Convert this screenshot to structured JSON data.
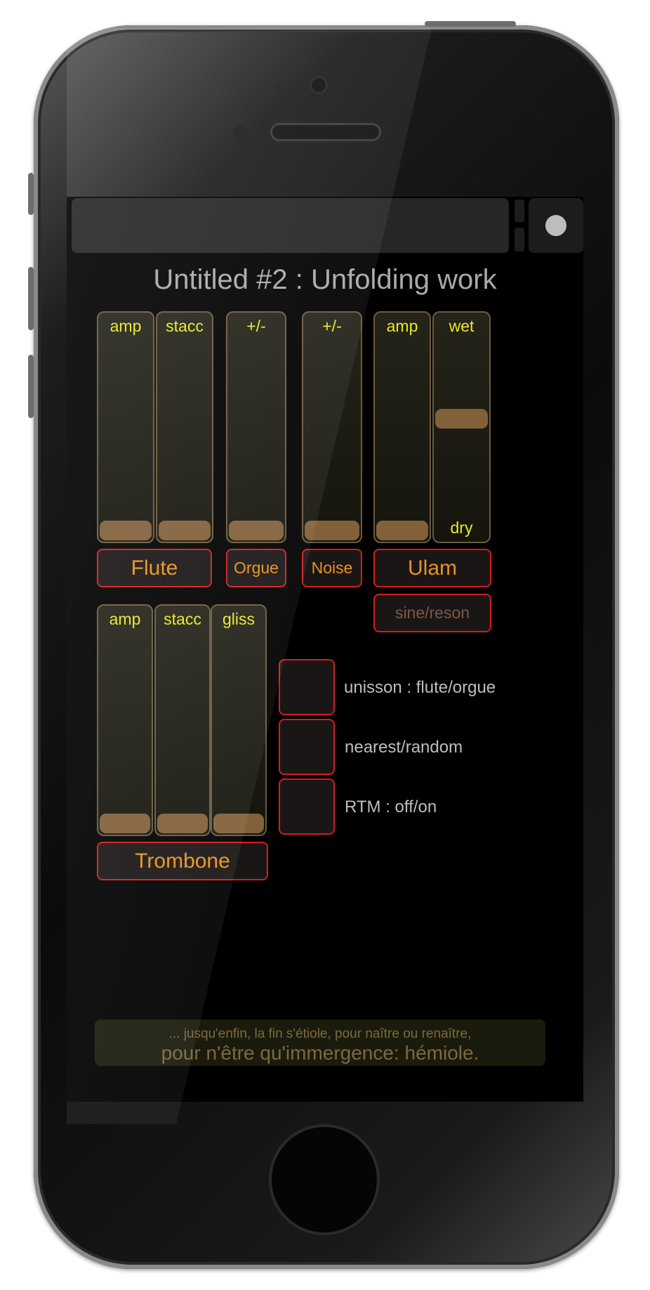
{
  "app": {
    "title": "Untitled #2 : Unfolding work",
    "record_icon": "record-icon"
  },
  "sliders": [
    {
      "id": "flute-amp",
      "label": "amp",
      "value": 0
    },
    {
      "id": "flute-stacc",
      "label": "stacc",
      "value": 0
    },
    {
      "id": "orgue-plusminus",
      "label": "+/-",
      "value": 0
    },
    {
      "id": "noise-plusminus",
      "label": "+/-",
      "value": 0
    },
    {
      "id": "ulam-amp",
      "label": "amp",
      "value": 0
    },
    {
      "id": "ulam-wetdry",
      "label": "wet",
      "label_bottom": "dry",
      "value": 0.54
    },
    {
      "id": "trombone-amp",
      "label": "amp",
      "value": 0
    },
    {
      "id": "trombone-stacc",
      "label": "stacc",
      "value": 0
    },
    {
      "id": "trombone-gliss",
      "label": "gliss",
      "value": 0
    }
  ],
  "buttons": {
    "flute": "Flute",
    "orgue": "Orgue",
    "noise": "Noise",
    "ulam": "Ulam",
    "sine_reson": "sine/reson",
    "trombone": "Trombone"
  },
  "toggles": [
    {
      "label": "unisson : flute/orgue",
      "on": false
    },
    {
      "label": "nearest/random",
      "on": false
    },
    {
      "label": "RTM : off/on",
      "on": false
    }
  ],
  "footer": {
    "line1": "... jusqu'enfin, la fin s'étiole, pour naître ou renaître,",
    "line2": "pour n'être qu'immergence: hémiole."
  },
  "colors": {
    "accent_orange": "#e9921f",
    "border_red": "#d01e1e",
    "slider_label_yellow": "#e8e824",
    "handle_brown": "#82603a"
  }
}
